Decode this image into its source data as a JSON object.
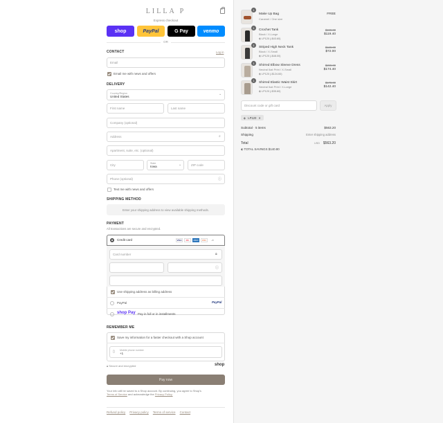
{
  "header": {
    "logo": "LILLA P"
  },
  "express": {
    "label": "Express checkout",
    "buttons": [
      {
        "label": "shop",
        "color": "#5a31f4"
      },
      {
        "label": "PayPal",
        "color": "#ffc439"
      },
      {
        "label": "G Pay",
        "color": "#000000"
      },
      {
        "label": "venmo",
        "color": "#008cff"
      }
    ],
    "or": "OR"
  },
  "contact": {
    "title": "CONTACT",
    "login": "Log in",
    "email_placeholder": "Email",
    "news_label": "Email me with news and offers"
  },
  "delivery": {
    "title": "DELIVERY",
    "country_label": "Country/Region",
    "country_value": "United States",
    "first_name": "First name",
    "last_name": "Last name",
    "company": "Company (optional)",
    "address": "Address",
    "apartment": "Apartment, suite, etc. (optional)",
    "city": "City",
    "state_label": "State",
    "state_value": "Iowa",
    "zip": "ZIP code",
    "phone": "Phone (optional)",
    "text_label": "Text me with news and offers"
  },
  "shipping": {
    "title": "SHIPPING METHOD",
    "message": "Enter your shipping address to view available shipping methods."
  },
  "payment": {
    "title": "PAYMENT",
    "subtitle": "All transactions are secure and encrypted.",
    "credit_label": "Credit card",
    "card_icons": [
      "VISA",
      "MC",
      "AMEX",
      "DISC",
      "+5"
    ],
    "card_number": "Card number",
    "billing_label": "Use shipping address as billing address",
    "paypal_label": "PayPal",
    "paypal_logo": "PayPal",
    "shoppay_logo": "shop Pay",
    "shoppay_label": "Pay in full or in installments"
  },
  "remember": {
    "title": "REMEMBER ME",
    "save_label": "Save my information for a faster checkout with a Shop account",
    "phone_label": "Mobile phone number",
    "phone_value": "+1",
    "secure": "Secure and encrypted",
    "shop_logo": "shop"
  },
  "pay_now": "Pay now",
  "legal": {
    "line1": "Your info will be saved to a Shop account. By continuing, you agree to Shop's",
    "terms": "Terms of Service",
    "and": "and acknowledge the",
    "privacy": "Privacy Policy."
  },
  "footer_links": [
    "Refund policy",
    "Privacy policy",
    "Terms of service",
    "Contact"
  ],
  "order": {
    "items": [
      {
        "qty": "1",
        "name": "Make Up Bag",
        "variant": "Caramel / One size",
        "price": "FREE",
        "old": "",
        "disc": ""
      },
      {
        "qty": "1",
        "name": "Crochet Tank",
        "variant": "Black / X-Large",
        "price": "$119.40",
        "old": "$199.00",
        "disc": "LP120 (-$43.60)"
      },
      {
        "qty": "1",
        "name": "Striped High Neck Tank",
        "variant": "Black / X-Small",
        "price": "$72.00",
        "old": "$120.00",
        "disc": "LP120 (-$48.00)"
      },
      {
        "qty": "1",
        "name": "Shirred Elbow Sleeve Dress",
        "variant": "Neutral Ikat Print / X-Small",
        "price": "$174.40",
        "old": "$299.00",
        "disc": "LP120 (-$124.60)"
      },
      {
        "qty": "1",
        "name": "Shirred Elastic Waist Skirt",
        "variant": "Neutral Ikat Print / X-Large",
        "price": "$142.40",
        "old": "$178.00",
        "disc": "LP120 (-$35.60)"
      }
    ],
    "discount_placeholder": "Discount code or gift card",
    "apply": "Apply",
    "code_tag": "LP120",
    "subtotal_label": "Subtotal · 5 items",
    "subtotal_value": "$563.20",
    "shipping_label": "Shipping",
    "shipping_value": "Enter shipping address",
    "total_label": "Total",
    "currency": "USD",
    "total_value": "$563.20",
    "savings_label": "TOTAL SAVINGS",
    "savings_value": "$140.80"
  }
}
